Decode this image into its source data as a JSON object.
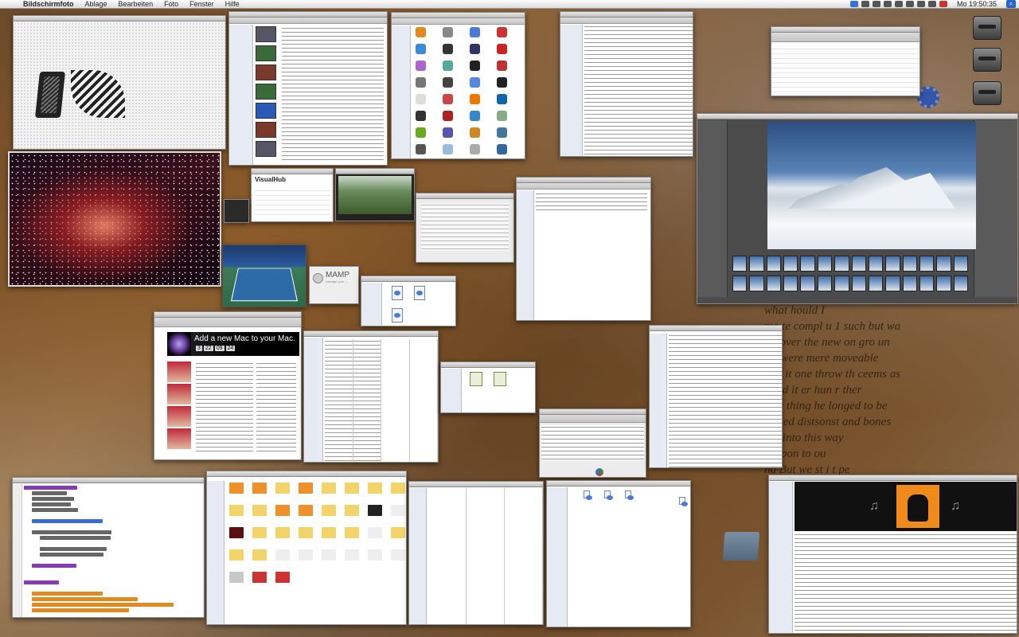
{
  "menubar": {
    "apple": "",
    "app_name": "Bildschirmfoto",
    "menus": [
      "Ablage",
      "Bearbeiten",
      "Foto",
      "Fenster",
      "Hilfe"
    ],
    "clock": "Mo 19:50:35"
  },
  "desktop": {
    "background_text": "what  hould I\nmo te compl u 1 such but wa\nall over the new on gro un\nwe were mere moveable\nhad it one throw th ceems as\nd did it er hun r ther\nther thing he longed to be\nsed ed distsonst  and bones\nnto into this way\n     by,  pon to ou\nnd  But  we st i t pe"
  },
  "windows": {
    "visualhub": {
      "title": "VisualHub"
    },
    "mamp": {
      "title": "MAMP",
      "subtitle": "manage your ..."
    },
    "safari": {
      "banner_title": "Add a new Mac to your Mac.",
      "countdown": [
        "3",
        "22",
        "09",
        "24"
      ]
    }
  },
  "colors": {
    "menubar_accent": "#2a64c8",
    "folder_yellow": "#f2d46a",
    "folder_orange": "#f0902a"
  }
}
